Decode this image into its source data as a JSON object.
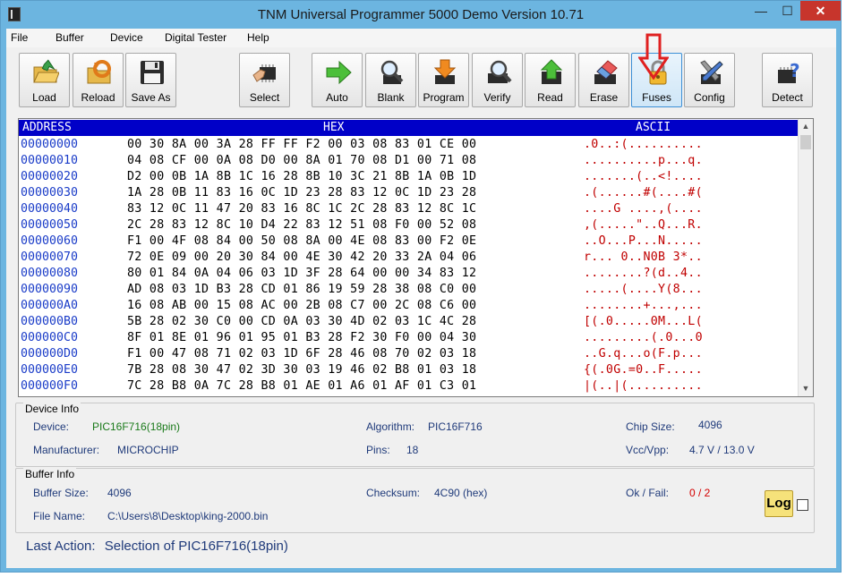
{
  "window": {
    "title": "TNM  Universal Programmer 5000 Demo   Version 10.71",
    "minimize": "—",
    "maximize": "☐",
    "close": "✕"
  },
  "menu": [
    "File",
    "Buffer",
    "Device",
    "Digital Tester",
    "Help"
  ],
  "toolbar": {
    "load": "Load",
    "reload": "Reload",
    "save_as": "Save As",
    "select": "Select",
    "auto": "Auto",
    "blank": "Blank",
    "program": "Program",
    "verify": "Verify",
    "read": "Read",
    "erase": "Erase",
    "fuses": "Fuses",
    "config": "Config",
    "detect": "Detect"
  },
  "hex_view": {
    "headers": {
      "address": "ADDRESS",
      "hex": "HEX",
      "ascii": "ASCII"
    },
    "rows": [
      {
        "addr": "00000000",
        "bytes": "00 30 8A 00 3A 28 FF FF F2 00 03 08 83 01 CE 00",
        "ascii": ".0..:(.........."
      },
      {
        "addr": "00000010",
        "bytes": "04 08 CF 00 0A 08 D0 00 8A 01 70 08 D1 00 71 08",
        "ascii": "..........p...q."
      },
      {
        "addr": "00000020",
        "bytes": "D2 00 0B 1A 8B 1C 16 28 8B 10 3C 21 8B 1A 0B 1D",
        "ascii": ".......(..<!...."
      },
      {
        "addr": "00000030",
        "bytes": "1A 28 0B 11 83 16 0C 1D 23 28 83 12 0C 1D 23 28",
        "ascii": ".(......#(....#("
      },
      {
        "addr": "00000040",
        "bytes": "83 12 0C 11 47 20 83 16 8C 1C 2C 28 83 12 8C 1C",
        "ascii": "....G ....,(...."
      },
      {
        "addr": "00000050",
        "bytes": "2C 28 83 12 8C 10 D4 22 83 12 51 08 F0 00 52 08",
        "ascii": ",(.....\"..Q...R."
      },
      {
        "addr": "00000060",
        "bytes": "F1 00 4F 08 84 00 50 08 8A 00 4E 08 83 00 F2 0E",
        "ascii": "..O...P...N....."
      },
      {
        "addr": "00000070",
        "bytes": "72 0E 09 00 20 30 84 00 4E 30 42 20 33 2A 04 06",
        "ascii": "r... 0..N0B 3*.."
      },
      {
        "addr": "00000080",
        "bytes": "80 01 84 0A 04 06 03 1D 3F 28 64 00 00 34 83 12",
        "ascii": "........?(d..4.."
      },
      {
        "addr": "00000090",
        "bytes": "AD 08 03 1D B3 28 CD 01 86 19 59 28 38 08 C0 00",
        "ascii": ".....(....Y(8..."
      },
      {
        "addr": "000000A0",
        "bytes": "16 08 AB 00 15 08 AC 00 2B 08 C7 00 2C 08 C6 00",
        "ascii": "........+...,..."
      },
      {
        "addr": "000000B0",
        "bytes": "5B 28 02 30 C0 00 CD 0A 03 30 4D 02 03 1C 4C 28",
        "ascii": "[(.0.....0M...L("
      },
      {
        "addr": "000000C0",
        "bytes": "8F 01 8E 01 96 01 95 01 B3 28 F2 30 F0 00 04 30",
        "ascii": ".........(.0...0"
      },
      {
        "addr": "000000D0",
        "bytes": "F1 00 47 08 71 02 03 1D 6F 28 46 08 70 02 03 18",
        "ascii": "..G.q...o(F.p..."
      },
      {
        "addr": "000000E0",
        "bytes": "7B 28 08 30 47 02 3D 30 03 19 46 02 B8 01 03 18",
        "ascii": "{(.0G.=0..F....."
      },
      {
        "addr": "000000F0",
        "bytes": "7C 28 B8 0A 7C 28 B8 01 AE 01 A6 01 AF 01 C3 01",
        "ascii": "|(..|(.........."
      }
    ]
  },
  "device_info": {
    "title": "Device Info",
    "device_label": "Device:",
    "device_value": "PIC16F716(18pin)",
    "algorithm_label": "Algorithm:",
    "algorithm_value": "PIC16F716",
    "chip_size_label": "Chip Size:",
    "chip_size_value": "4096",
    "manufacturer_label": "Manufacturer:",
    "manufacturer_value": "MICROCHIP",
    "pins_label": "Pins:",
    "pins_value": "18",
    "vcc_label": "Vcc/Vpp:",
    "vcc_value": "4.7 V / 13.0 V"
  },
  "buffer_info": {
    "title": "Buffer Info",
    "size_label": "Buffer Size:",
    "size_value": "4096",
    "checksum_label": "Checksum:",
    "checksum_value": "4C90 (hex)",
    "okfail_label": "Ok / Fail:",
    "okfail_value": "0 / 2",
    "filename_label": "File Name:",
    "filename_value": "C:\\Users\\8\\Desktop\\king-2000.bin",
    "log_label": "Log"
  },
  "status": {
    "last_action_label": "Last Action:",
    "last_action_value": "Selection of    PIC16F716(18pin)"
  },
  "colors": {
    "title_bar": "#6cb5e0",
    "header_bg": "#0000c8",
    "address_text": "#1a3cc8",
    "ascii_text": "#c00000",
    "annotation_arrow": "#e02020"
  }
}
